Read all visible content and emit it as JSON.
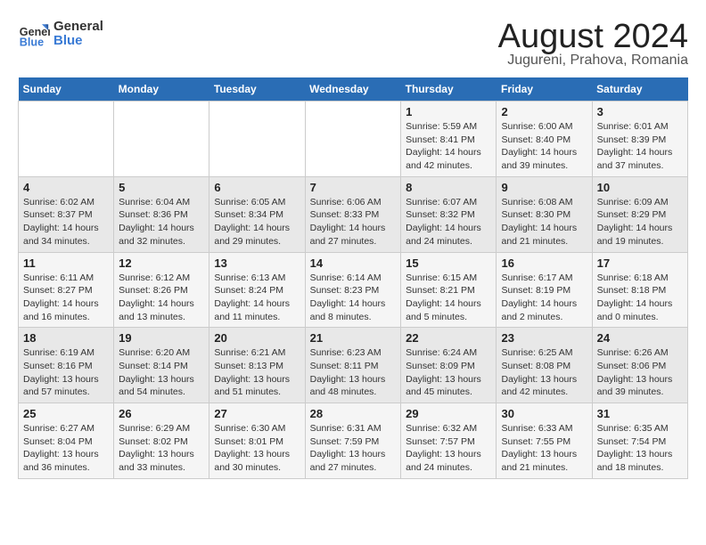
{
  "header": {
    "logo_line1": "General",
    "logo_line2": "Blue",
    "month_year": "August 2024",
    "location": "Jugureni, Prahova, Romania"
  },
  "weekdays": [
    "Sunday",
    "Monday",
    "Tuesday",
    "Wednesday",
    "Thursday",
    "Friday",
    "Saturday"
  ],
  "weeks": [
    [
      {
        "day": "",
        "detail": ""
      },
      {
        "day": "",
        "detail": ""
      },
      {
        "day": "",
        "detail": ""
      },
      {
        "day": "",
        "detail": ""
      },
      {
        "day": "1",
        "detail": "Sunrise: 5:59 AM\nSunset: 8:41 PM\nDaylight: 14 hours and 42 minutes."
      },
      {
        "day": "2",
        "detail": "Sunrise: 6:00 AM\nSunset: 8:40 PM\nDaylight: 14 hours and 39 minutes."
      },
      {
        "day": "3",
        "detail": "Sunrise: 6:01 AM\nSunset: 8:39 PM\nDaylight: 14 hours and 37 minutes."
      }
    ],
    [
      {
        "day": "4",
        "detail": "Sunrise: 6:02 AM\nSunset: 8:37 PM\nDaylight: 14 hours and 34 minutes."
      },
      {
        "day": "5",
        "detail": "Sunrise: 6:04 AM\nSunset: 8:36 PM\nDaylight: 14 hours and 32 minutes."
      },
      {
        "day": "6",
        "detail": "Sunrise: 6:05 AM\nSunset: 8:34 PM\nDaylight: 14 hours and 29 minutes."
      },
      {
        "day": "7",
        "detail": "Sunrise: 6:06 AM\nSunset: 8:33 PM\nDaylight: 14 hours and 27 minutes."
      },
      {
        "day": "8",
        "detail": "Sunrise: 6:07 AM\nSunset: 8:32 PM\nDaylight: 14 hours and 24 minutes."
      },
      {
        "day": "9",
        "detail": "Sunrise: 6:08 AM\nSunset: 8:30 PM\nDaylight: 14 hours and 21 minutes."
      },
      {
        "day": "10",
        "detail": "Sunrise: 6:09 AM\nSunset: 8:29 PM\nDaylight: 14 hours and 19 minutes."
      }
    ],
    [
      {
        "day": "11",
        "detail": "Sunrise: 6:11 AM\nSunset: 8:27 PM\nDaylight: 14 hours and 16 minutes."
      },
      {
        "day": "12",
        "detail": "Sunrise: 6:12 AM\nSunset: 8:26 PM\nDaylight: 14 hours and 13 minutes."
      },
      {
        "day": "13",
        "detail": "Sunrise: 6:13 AM\nSunset: 8:24 PM\nDaylight: 14 hours and 11 minutes."
      },
      {
        "day": "14",
        "detail": "Sunrise: 6:14 AM\nSunset: 8:23 PM\nDaylight: 14 hours and 8 minutes."
      },
      {
        "day": "15",
        "detail": "Sunrise: 6:15 AM\nSunset: 8:21 PM\nDaylight: 14 hours and 5 minutes."
      },
      {
        "day": "16",
        "detail": "Sunrise: 6:17 AM\nSunset: 8:19 PM\nDaylight: 14 hours and 2 minutes."
      },
      {
        "day": "17",
        "detail": "Sunrise: 6:18 AM\nSunset: 8:18 PM\nDaylight: 14 hours and 0 minutes."
      }
    ],
    [
      {
        "day": "18",
        "detail": "Sunrise: 6:19 AM\nSunset: 8:16 PM\nDaylight: 13 hours and 57 minutes."
      },
      {
        "day": "19",
        "detail": "Sunrise: 6:20 AM\nSunset: 8:14 PM\nDaylight: 13 hours and 54 minutes."
      },
      {
        "day": "20",
        "detail": "Sunrise: 6:21 AM\nSunset: 8:13 PM\nDaylight: 13 hours and 51 minutes."
      },
      {
        "day": "21",
        "detail": "Sunrise: 6:23 AM\nSunset: 8:11 PM\nDaylight: 13 hours and 48 minutes."
      },
      {
        "day": "22",
        "detail": "Sunrise: 6:24 AM\nSunset: 8:09 PM\nDaylight: 13 hours and 45 minutes."
      },
      {
        "day": "23",
        "detail": "Sunrise: 6:25 AM\nSunset: 8:08 PM\nDaylight: 13 hours and 42 minutes."
      },
      {
        "day": "24",
        "detail": "Sunrise: 6:26 AM\nSunset: 8:06 PM\nDaylight: 13 hours and 39 minutes."
      }
    ],
    [
      {
        "day": "25",
        "detail": "Sunrise: 6:27 AM\nSunset: 8:04 PM\nDaylight: 13 hours and 36 minutes."
      },
      {
        "day": "26",
        "detail": "Sunrise: 6:29 AM\nSunset: 8:02 PM\nDaylight: 13 hours and 33 minutes."
      },
      {
        "day": "27",
        "detail": "Sunrise: 6:30 AM\nSunset: 8:01 PM\nDaylight: 13 hours and 30 minutes."
      },
      {
        "day": "28",
        "detail": "Sunrise: 6:31 AM\nSunset: 7:59 PM\nDaylight: 13 hours and 27 minutes."
      },
      {
        "day": "29",
        "detail": "Sunrise: 6:32 AM\nSunset: 7:57 PM\nDaylight: 13 hours and 24 minutes."
      },
      {
        "day": "30",
        "detail": "Sunrise: 6:33 AM\nSunset: 7:55 PM\nDaylight: 13 hours and 21 minutes."
      },
      {
        "day": "31",
        "detail": "Sunrise: 6:35 AM\nSunset: 7:54 PM\nDaylight: 13 hours and 18 minutes."
      }
    ]
  ]
}
